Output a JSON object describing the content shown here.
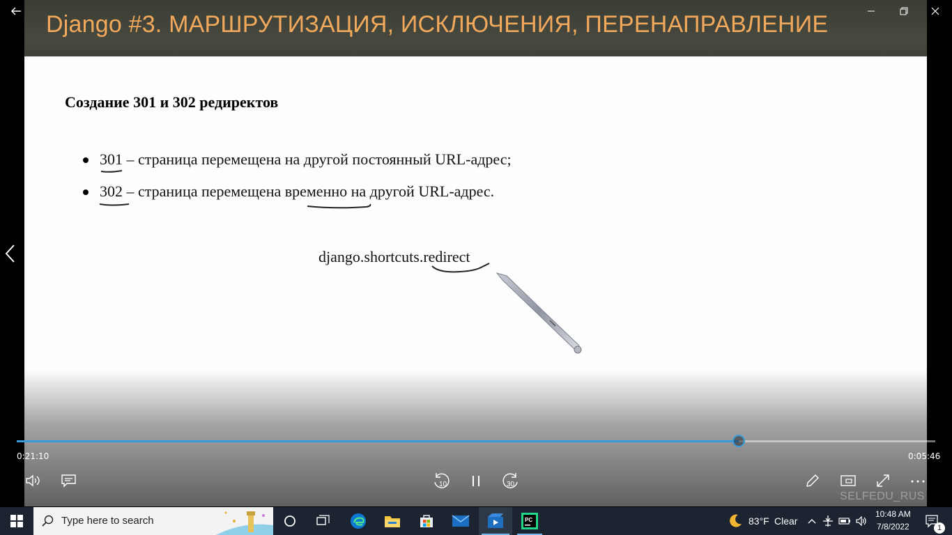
{
  "video": {
    "title": "Django #3. МАРШРУТИЗАЦИЯ, ИСКЛЮЧЕНИЯ, ПЕРЕНАПРАВЛЕНИЕ",
    "slide": {
      "heading": "Создание 301 и 302 редиректов",
      "bullets": [
        {
          "code": "301",
          "text": " – страница перемещена на другой постоянный URL-адрес;"
        },
        {
          "code": "302",
          "text_before": " – страница перемещена ",
          "emphasis": "временно",
          "text_after": " на другой URL-адрес."
        }
      ],
      "code_prefix": "django.shortcuts.",
      "code_emphasis": "redirect"
    },
    "watermark": "SELFEDU_RUS"
  },
  "player": {
    "elapsed": "0:21:10",
    "remaining": "0:05:46",
    "progress": 0.786,
    "accent_color": "#3a9bdc",
    "controls": [
      "volume-icon",
      "captions-icon",
      "rewind-10-icon",
      "pause-icon",
      "forward-30-icon",
      "pen-icon",
      "mini-view-icon",
      "fullscreen-icon",
      "more-icon"
    ],
    "rewind_label": "10",
    "forward_label": "30"
  },
  "taskbar": {
    "search_placeholder": "Type here to search",
    "apps": [
      "start-icon",
      "cortana-icon",
      "task-view-icon",
      "edge-icon",
      "file-explorer-icon",
      "store-icon",
      "mail-icon",
      "movies-tv-icon",
      "pycharm-icon"
    ],
    "weather": {
      "temp": "83°F",
      "condition": "Clear"
    },
    "time": "10:48 AM",
    "date": "7/8/2022",
    "notification_count": "1"
  }
}
